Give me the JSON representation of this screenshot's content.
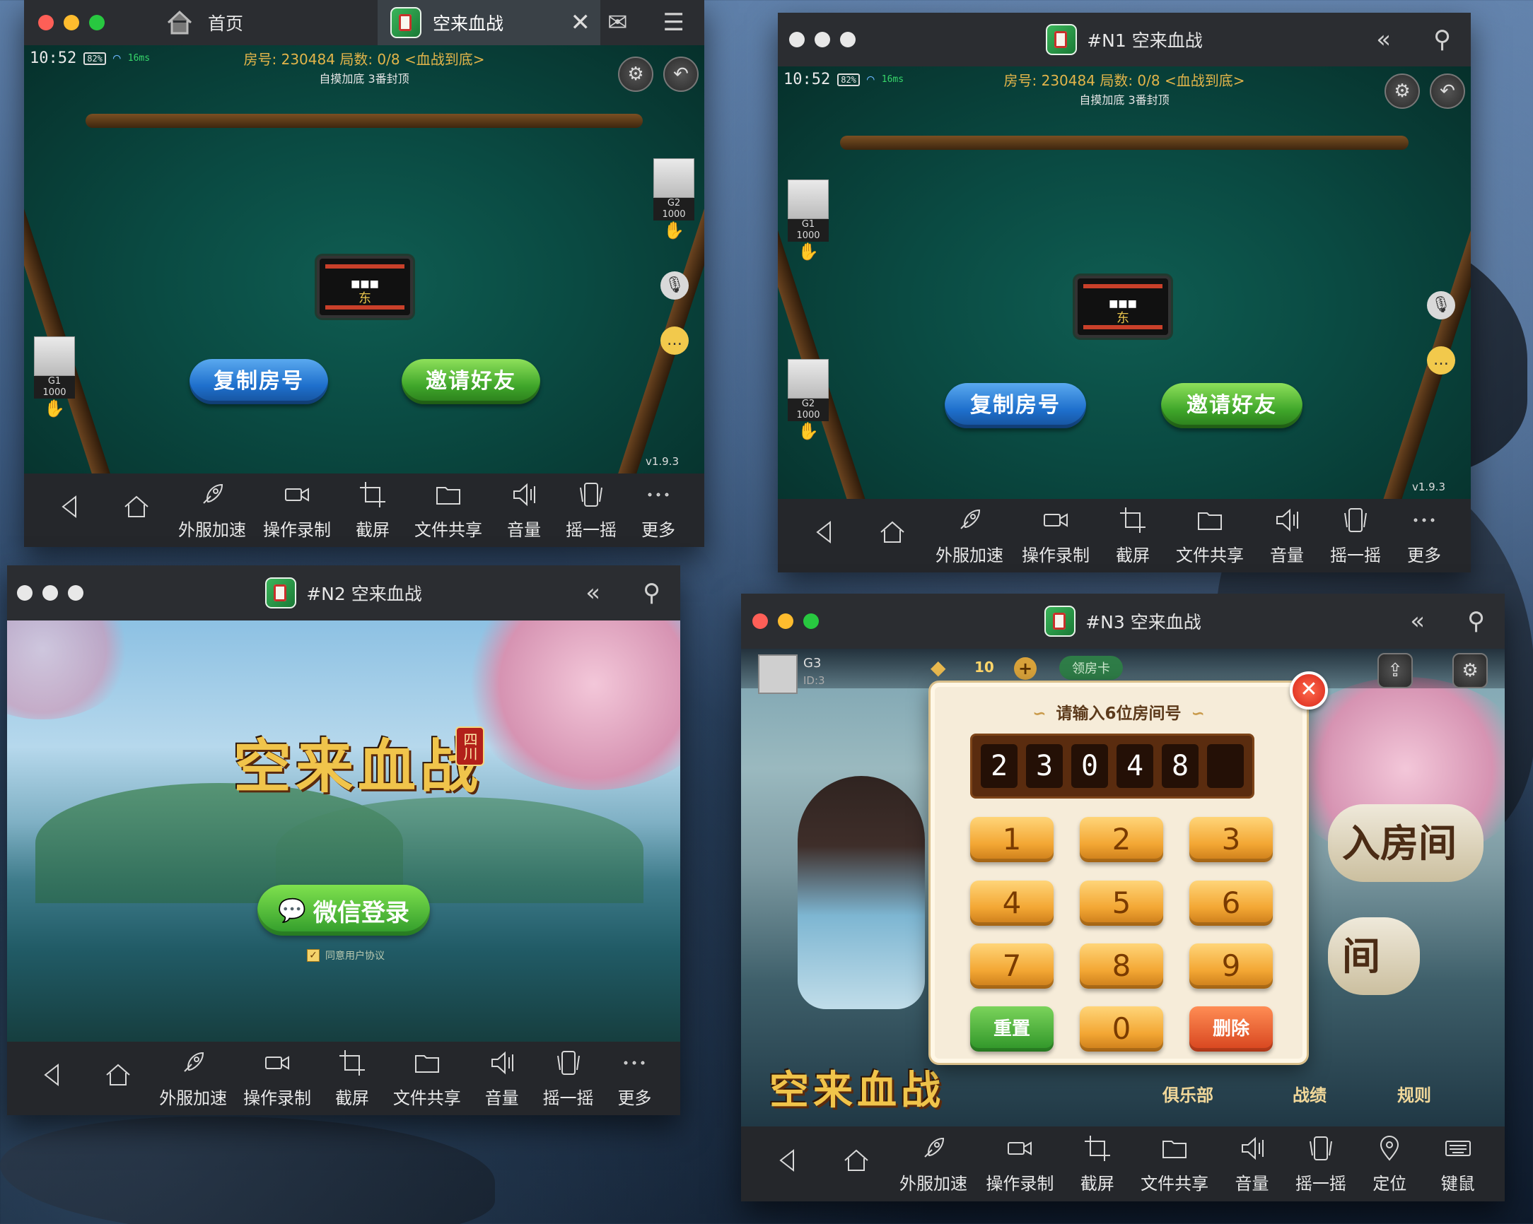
{
  "windows": {
    "main": {
      "home_tab": "首页",
      "active_tab": "空来血战",
      "hud": {
        "time": "10:52",
        "battery": "82%",
        "ping": "16ms",
        "room_info": "房号: 230484 局数: 0/8 <血战到底>",
        "rules": "自摸加底 3番封顶"
      },
      "seats": [
        {
          "name": "G2",
          "score": "1000"
        },
        {
          "name": "G1",
          "score": "1000"
        }
      ],
      "compass_tiles": "■■■",
      "compass_east": "东",
      "copy_room_button": "复制房号",
      "invite_button": "邀请好友",
      "version": "v1.9.3"
    },
    "n1": {
      "title": "#N1 空来血战",
      "hud": {
        "time": "10:52",
        "battery": "82%",
        "ping": "16ms",
        "room_info": "房号: 230484 局数: 0/8 <血战到底>",
        "rules": "自摸加底 3番封顶"
      },
      "seats": [
        {
          "name": "G1",
          "score": "1000"
        },
        {
          "name": "G2",
          "score": "1000"
        }
      ],
      "compass_tiles": "■■■",
      "compass_east": "东",
      "copy_room_button": "复制房号",
      "invite_button": "邀请好友",
      "version": "v1.9.3"
    },
    "n2": {
      "title": "#N2 空来血战",
      "logo": "空来血战",
      "region_badge": "四川",
      "wechat_login": "微信登录",
      "agree_text": "同意用户协议"
    },
    "n3": {
      "title": "#N3 空来血战",
      "player_name": "G3",
      "player_id": "ID:3",
      "coins": "10",
      "room_card_button": "领房卡",
      "dialog_title": "请输入6位房间号",
      "code_digits": [
        "2",
        "3",
        "0",
        "4",
        "8",
        ""
      ],
      "keys": [
        "1",
        "2",
        "3",
        "4",
        "5",
        "6",
        "7",
        "8",
        "9"
      ],
      "reset_key": "重置",
      "zero_key": "0",
      "delete_key": "删除",
      "lobby_card_1": "入房间",
      "lobby_card_2": "间",
      "bottom_logo": "空来血战",
      "bottom_items": [
        "俱乐部",
        "战绩",
        "规则"
      ]
    }
  },
  "toolbar_standard": [
    "外服加速",
    "操作录制",
    "截屏",
    "文件共享",
    "音量",
    "摇一摇",
    "更多"
  ],
  "toolbar_n3": [
    "外服加速",
    "操作录制",
    "截屏",
    "文件共享",
    "音量",
    "摇一摇",
    "定位",
    "键鼠"
  ],
  "colors": {
    "felt": "#0a4a42",
    "gold_text": "#e3b54a",
    "blue_button": "#1e6fcc",
    "green_button": "#3fa62a",
    "key_orange": "#f3a734"
  }
}
